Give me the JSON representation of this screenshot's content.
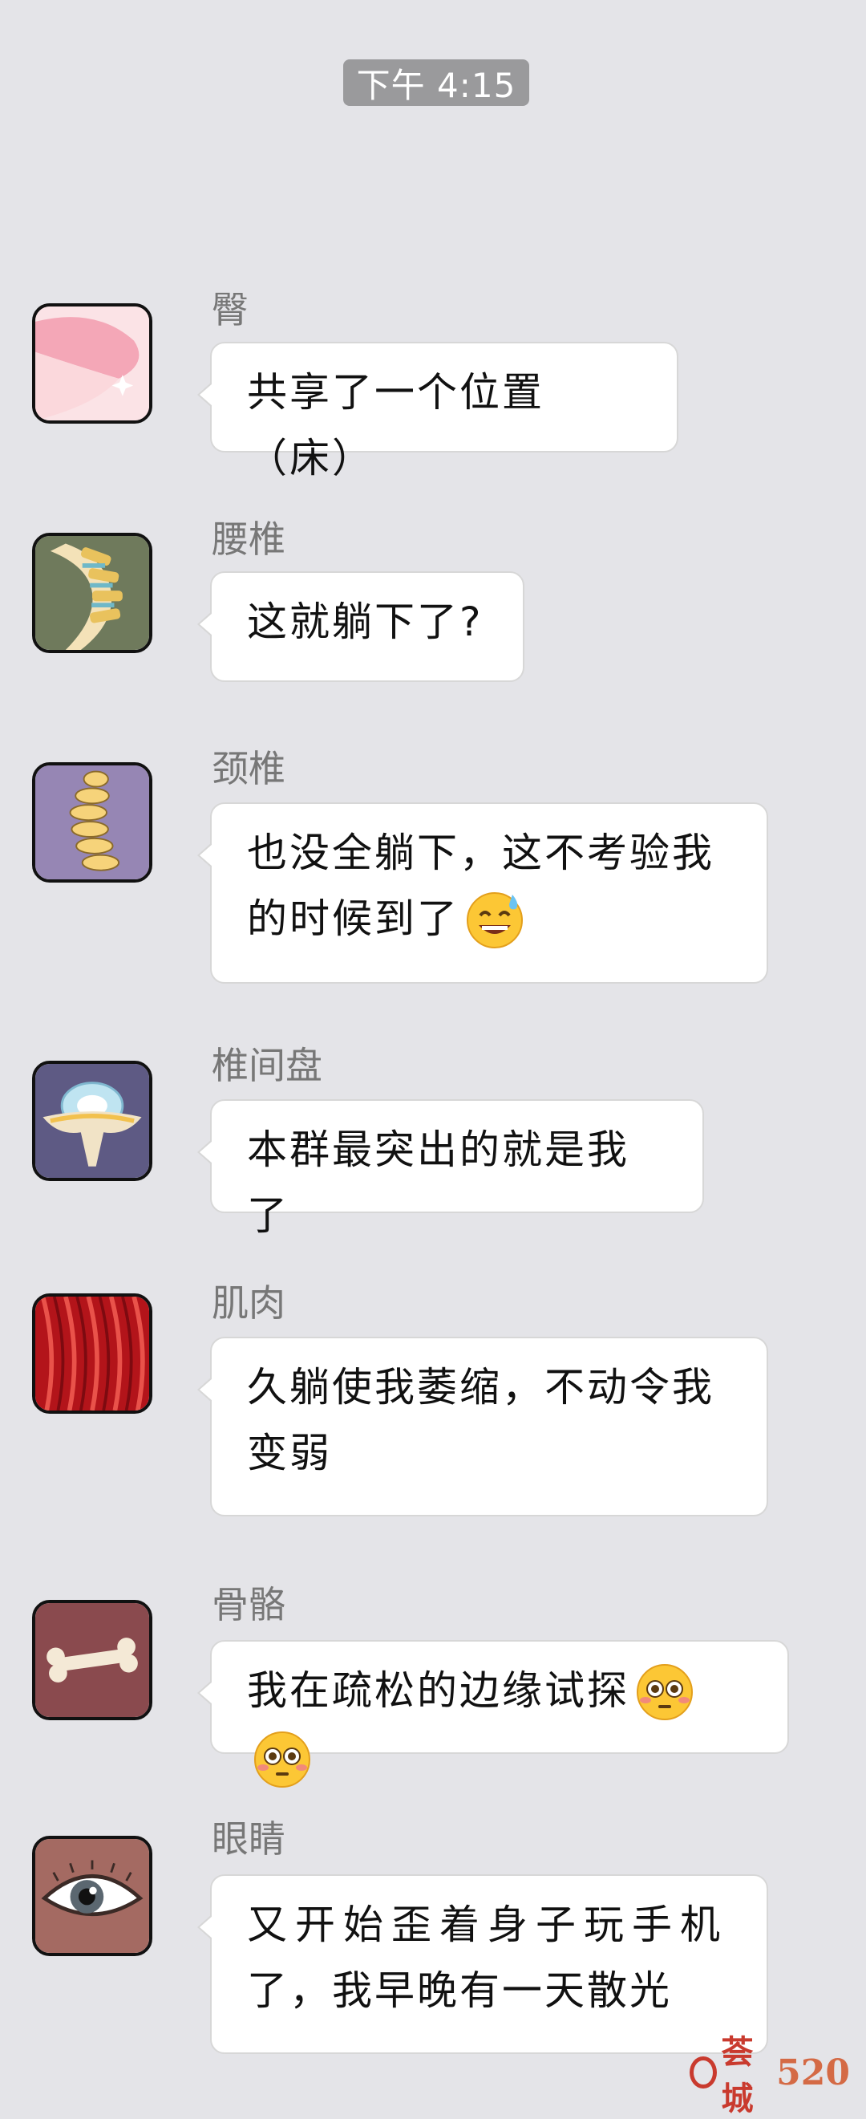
{
  "timestamp": "下午 4:15",
  "messages": [
    {
      "sender": "臀",
      "text": "共享了一个位置（床）"
    },
    {
      "sender": "腰椎",
      "text": "这就躺下了?"
    },
    {
      "sender": "颈椎",
      "line1": "也没全躺下，这不考验我",
      "line2": "的时候到了"
    },
    {
      "sender": "椎间盘",
      "text": "本群最突出的就是我了"
    },
    {
      "sender": "肌肉",
      "line1": "久躺使我萎缩，不动令我",
      "line2": "变弱"
    },
    {
      "sender": "骨骼",
      "text": "我在疏松的边缘试探"
    },
    {
      "sender": "眼睛",
      "line1": "又开始歪着身子玩手机",
      "line2": "了，我早晚有一天散光"
    }
  ],
  "emojis": {
    "sweat_smile": "sweat-smile-emoji",
    "flushed": "flushed-face-emoji"
  },
  "watermark": {
    "brand": "荟城",
    "number": "520"
  }
}
